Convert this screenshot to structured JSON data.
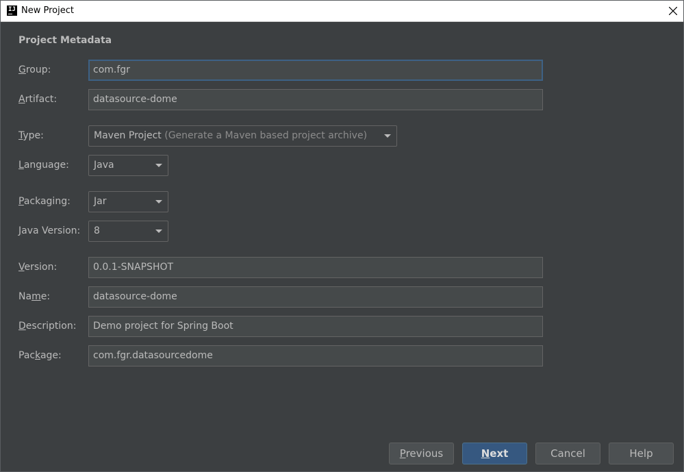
{
  "window": {
    "title": "New Project",
    "app_icon_text": "IJ"
  },
  "section_title": "Project Metadata",
  "fields": {
    "group": {
      "label_mnemonic": "G",
      "label_rest": "roup:",
      "value": "com.fgr"
    },
    "artifact": {
      "label_mnemonic": "A",
      "label_rest": "rtifact:",
      "value": "datasource-dome"
    },
    "type": {
      "label_mnemonic": "T",
      "label_rest": "ype:",
      "value": "Maven Project",
      "hint": "(Generate a Maven based project archive)"
    },
    "language": {
      "label_mnemonic": "L",
      "label_rest": "anguage:",
      "value": "Java"
    },
    "packaging": {
      "label_mnemonic": "P",
      "label_rest": "ackaging:",
      "value": "Jar"
    },
    "java_version": {
      "label_mnemonic": "J",
      "label_rest": "ava Version:",
      "value": "8"
    },
    "version": {
      "label_mnemonic": "V",
      "label_rest": "ersion:",
      "value": "0.0.1-SNAPSHOT"
    },
    "name": {
      "label_pre": "Na",
      "label_mnemonic": "m",
      "label_rest": "e:",
      "value": "datasource-dome"
    },
    "description": {
      "label_mnemonic": "D",
      "label_rest": "escription:",
      "value": "Demo project for Spring Boot"
    },
    "package": {
      "label_pre": "Pac",
      "label_mnemonic": "k",
      "label_rest": "age:",
      "value": "com.fgr.datasourcedome"
    }
  },
  "buttons": {
    "previous": {
      "mnemonic": "P",
      "rest": "revious"
    },
    "next": {
      "mnemonic": "N",
      "rest": "ext"
    },
    "cancel": "Cancel",
    "help": "Help"
  },
  "colors": {
    "background": "#3c3f41",
    "field_background": "#45494a",
    "focus_border": "#3d6185",
    "primary_button": "#365880",
    "text": "#bbbbbb"
  }
}
